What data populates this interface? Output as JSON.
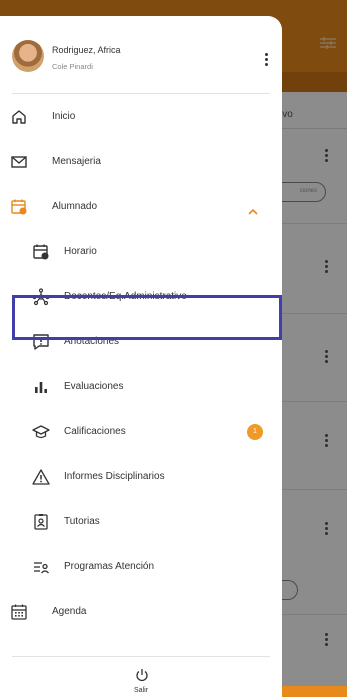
{
  "colors": {
    "accent": "#e8891c",
    "highlight": "#3f3fa7",
    "badge": "#f09a25"
  },
  "profile": {
    "name": "Rodriguez, Africa",
    "school": "Cole Pinardi"
  },
  "background": {
    "tab_fragment": "ivo",
    "pill_fragment": "ciones"
  },
  "menu": {
    "inicio": {
      "label": "Inicio",
      "icon": "home-icon"
    },
    "mensajeria": {
      "label": "Mensajeria",
      "icon": "mail-icon"
    },
    "alumnado": {
      "label": "Alumnado",
      "icon": "calendar-user-icon",
      "expanded": true
    },
    "horario": {
      "label": "Horario",
      "icon": "calendar-clock-icon"
    },
    "docentes": {
      "label": "Docentes/Eq.Administrativo",
      "icon": "network-icon",
      "selected": true
    },
    "anotaciones": {
      "label": "Anotaciones",
      "icon": "annotation-icon"
    },
    "evaluaciones": {
      "label": "Evaluaciones",
      "icon": "bar-chart-icon"
    },
    "calificaciones": {
      "label": "Calificaciones",
      "icon": "graduation-cap-icon",
      "badge": "1"
    },
    "informes": {
      "label": "Informes Disciplinarios",
      "icon": "warning-icon"
    },
    "tutorias": {
      "label": "Tutorias",
      "icon": "id-badge-icon"
    },
    "programas": {
      "label": "Programas Atención",
      "icon": "list-person-icon"
    },
    "agenda": {
      "label": "Agenda",
      "icon": "agenda-icon"
    }
  },
  "logout": {
    "label": "Salir",
    "icon": "power-icon"
  }
}
